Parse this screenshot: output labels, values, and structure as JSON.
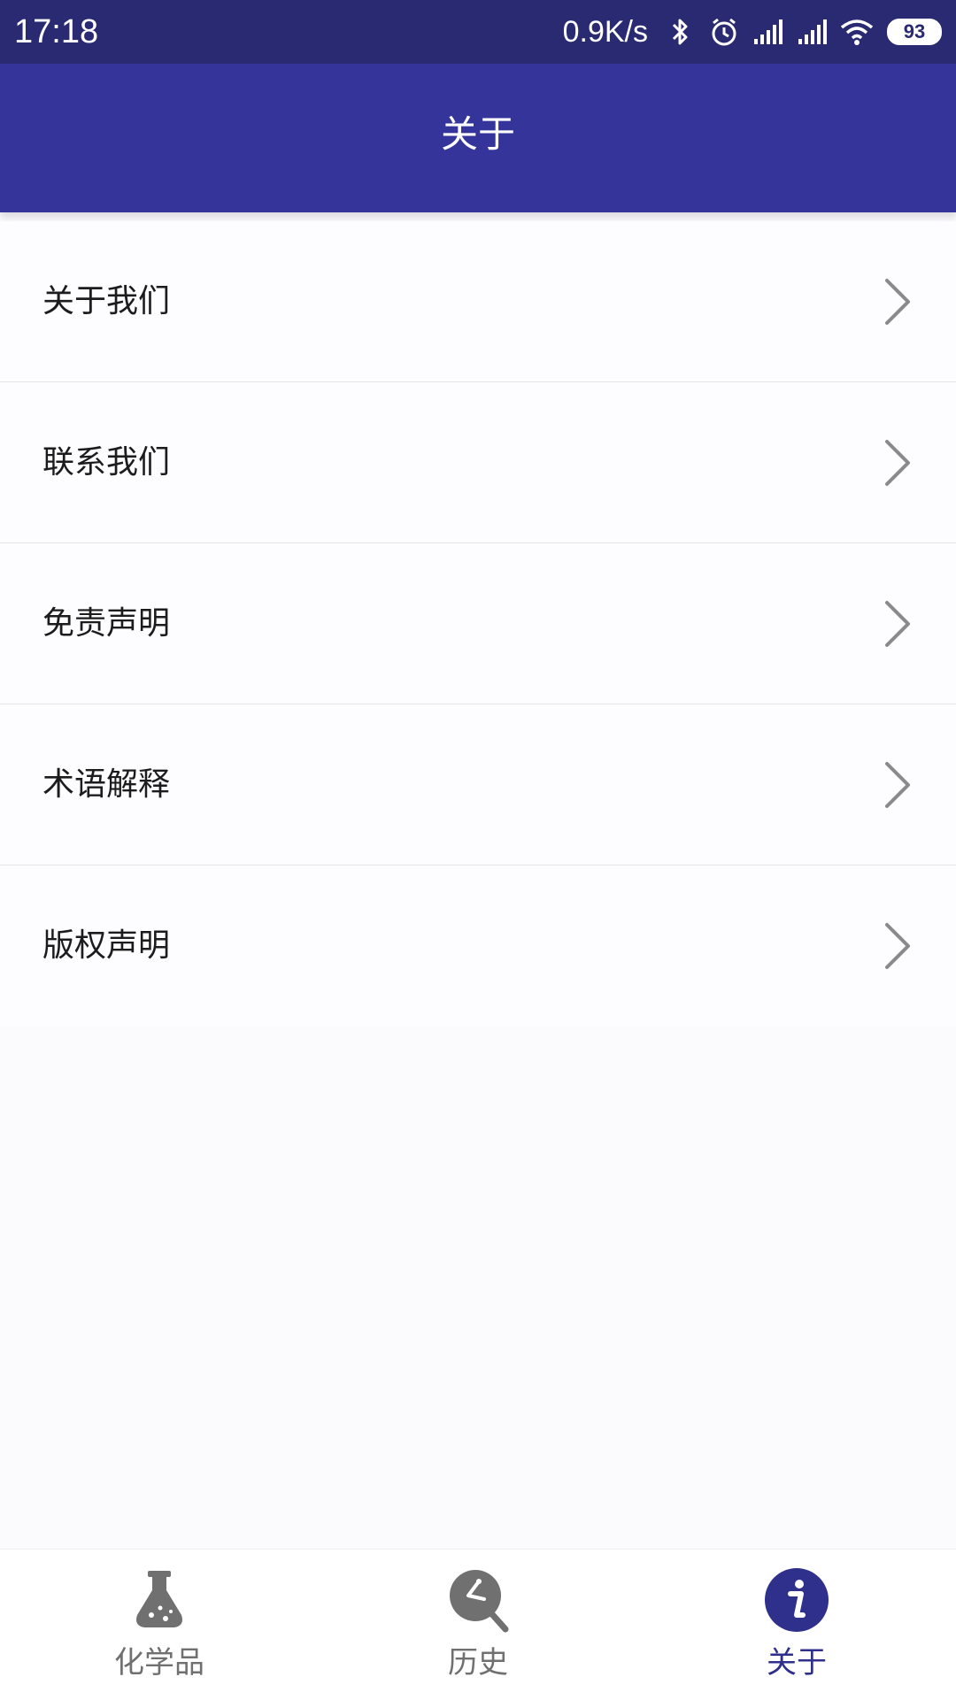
{
  "status_bar": {
    "time": "17:18",
    "net_speed": "0.9K/s",
    "battery": "93",
    "icons": [
      "bluetooth-icon",
      "alarm-icon",
      "signal-icon",
      "signal-icon",
      "wifi-icon",
      "battery-icon"
    ]
  },
  "app_bar": {
    "title": "关于"
  },
  "menu": {
    "items": [
      {
        "label": "关于我们"
      },
      {
        "label": "联系我们"
      },
      {
        "label": "免责声明"
      },
      {
        "label": "术语解释"
      },
      {
        "label": "版权声明"
      }
    ]
  },
  "bottom_nav": {
    "items": [
      {
        "label": "化学品",
        "icon": "flask-icon",
        "active": false
      },
      {
        "label": "历史",
        "icon": "history-search-icon",
        "active": false
      },
      {
        "label": "关于",
        "icon": "info-icon",
        "active": true
      }
    ]
  },
  "colors": {
    "status_bar": "#2a2a72",
    "app_bar": "#34349a",
    "accent": "#2f2f8c",
    "inactive": "#707070"
  }
}
